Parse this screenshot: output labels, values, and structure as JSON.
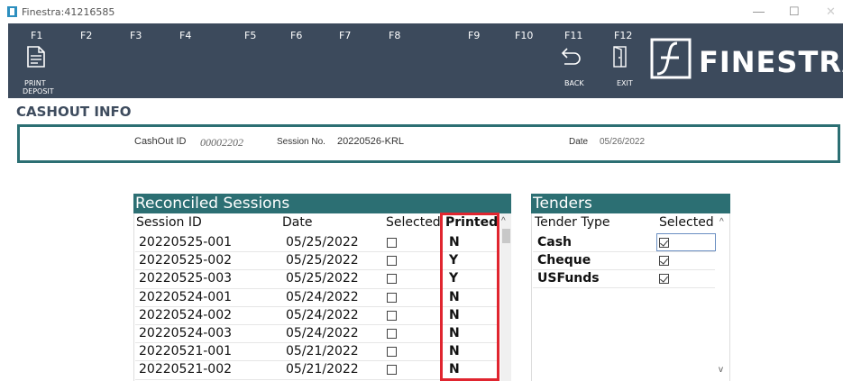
{
  "window": {
    "title": "Finestra:41216585",
    "controls": [
      "—",
      "☐",
      "✕"
    ]
  },
  "toolbar": {
    "fkeys": [
      "F1",
      "F2",
      "F3",
      "F4",
      "F5",
      "F6",
      "F7",
      "F8",
      "F9",
      "F10",
      "F11",
      "F12"
    ],
    "print_deposit_label_1": "PRINT",
    "print_deposit_label_2": "DEPOSIT",
    "back_label": "BACK",
    "exit_label": "EXIT",
    "brand": "FINESTRA"
  },
  "section": {
    "title": "CASHOUT INFO"
  },
  "info": {
    "cashout_label": "CashOut ID",
    "cashout_value": "00002202",
    "session_label": "Session No.",
    "session_value": "20220526-KRL",
    "date_label": "Date",
    "date_value": "05/26/2022"
  },
  "reconciled": {
    "title": "Reconciled Sessions",
    "columns": [
      "Session ID",
      "Date",
      "Selected",
      "Printed"
    ],
    "rows": [
      {
        "session_id": "20220525-001",
        "date": "05/25/2022",
        "selected": false,
        "printed": "N"
      },
      {
        "session_id": "20220525-002",
        "date": "05/25/2022",
        "selected": false,
        "printed": "Y"
      },
      {
        "session_id": "20220525-003",
        "date": "05/25/2022",
        "selected": false,
        "printed": "Y"
      },
      {
        "session_id": "20220524-001",
        "date": "05/24/2022",
        "selected": false,
        "printed": "N"
      },
      {
        "session_id": "20220524-002",
        "date": "05/24/2022",
        "selected": false,
        "printed": "N"
      },
      {
        "session_id": "20220524-003",
        "date": "05/24/2022",
        "selected": false,
        "printed": "N"
      },
      {
        "session_id": "20220521-001",
        "date": "05/21/2022",
        "selected": false,
        "printed": "N"
      },
      {
        "session_id": "20220521-002",
        "date": "05/21/2022",
        "selected": false,
        "printed": "N"
      }
    ]
  },
  "tenders": {
    "title": "Tenders",
    "columns": [
      "Tender Type",
      "Selected"
    ],
    "rows": [
      {
        "type": "Cash",
        "selected": true
      },
      {
        "type": "Cheque",
        "selected": true
      },
      {
        "type": "USFunds",
        "selected": true
      }
    ]
  },
  "icons": {
    "print": "document-icon",
    "back": "back-arrow-icon",
    "exit": "exit-door-icon",
    "logo": "finestra-logo-icon"
  },
  "colors": {
    "toolbar": "#3c4a5c",
    "teal": "#2c6f73",
    "highlight": "#e0252f"
  }
}
